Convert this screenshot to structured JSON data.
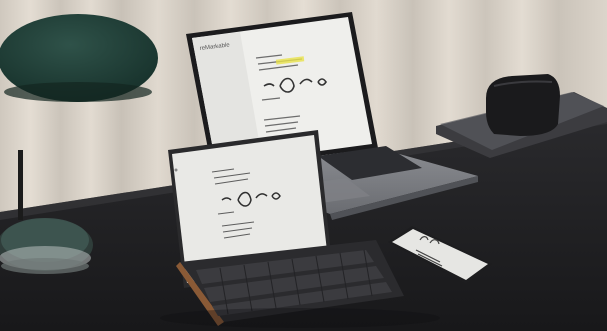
{
  "scene": {
    "description_free": true,
    "colors": {
      "curtain": "#d6cfc5",
      "desk": "#232326",
      "lamp_shade": "#1f3b34",
      "laptop_body": "#7d7f84",
      "screen": "#ececea"
    }
  },
  "laptop_screen": {
    "app_name": "reMarkable"
  }
}
